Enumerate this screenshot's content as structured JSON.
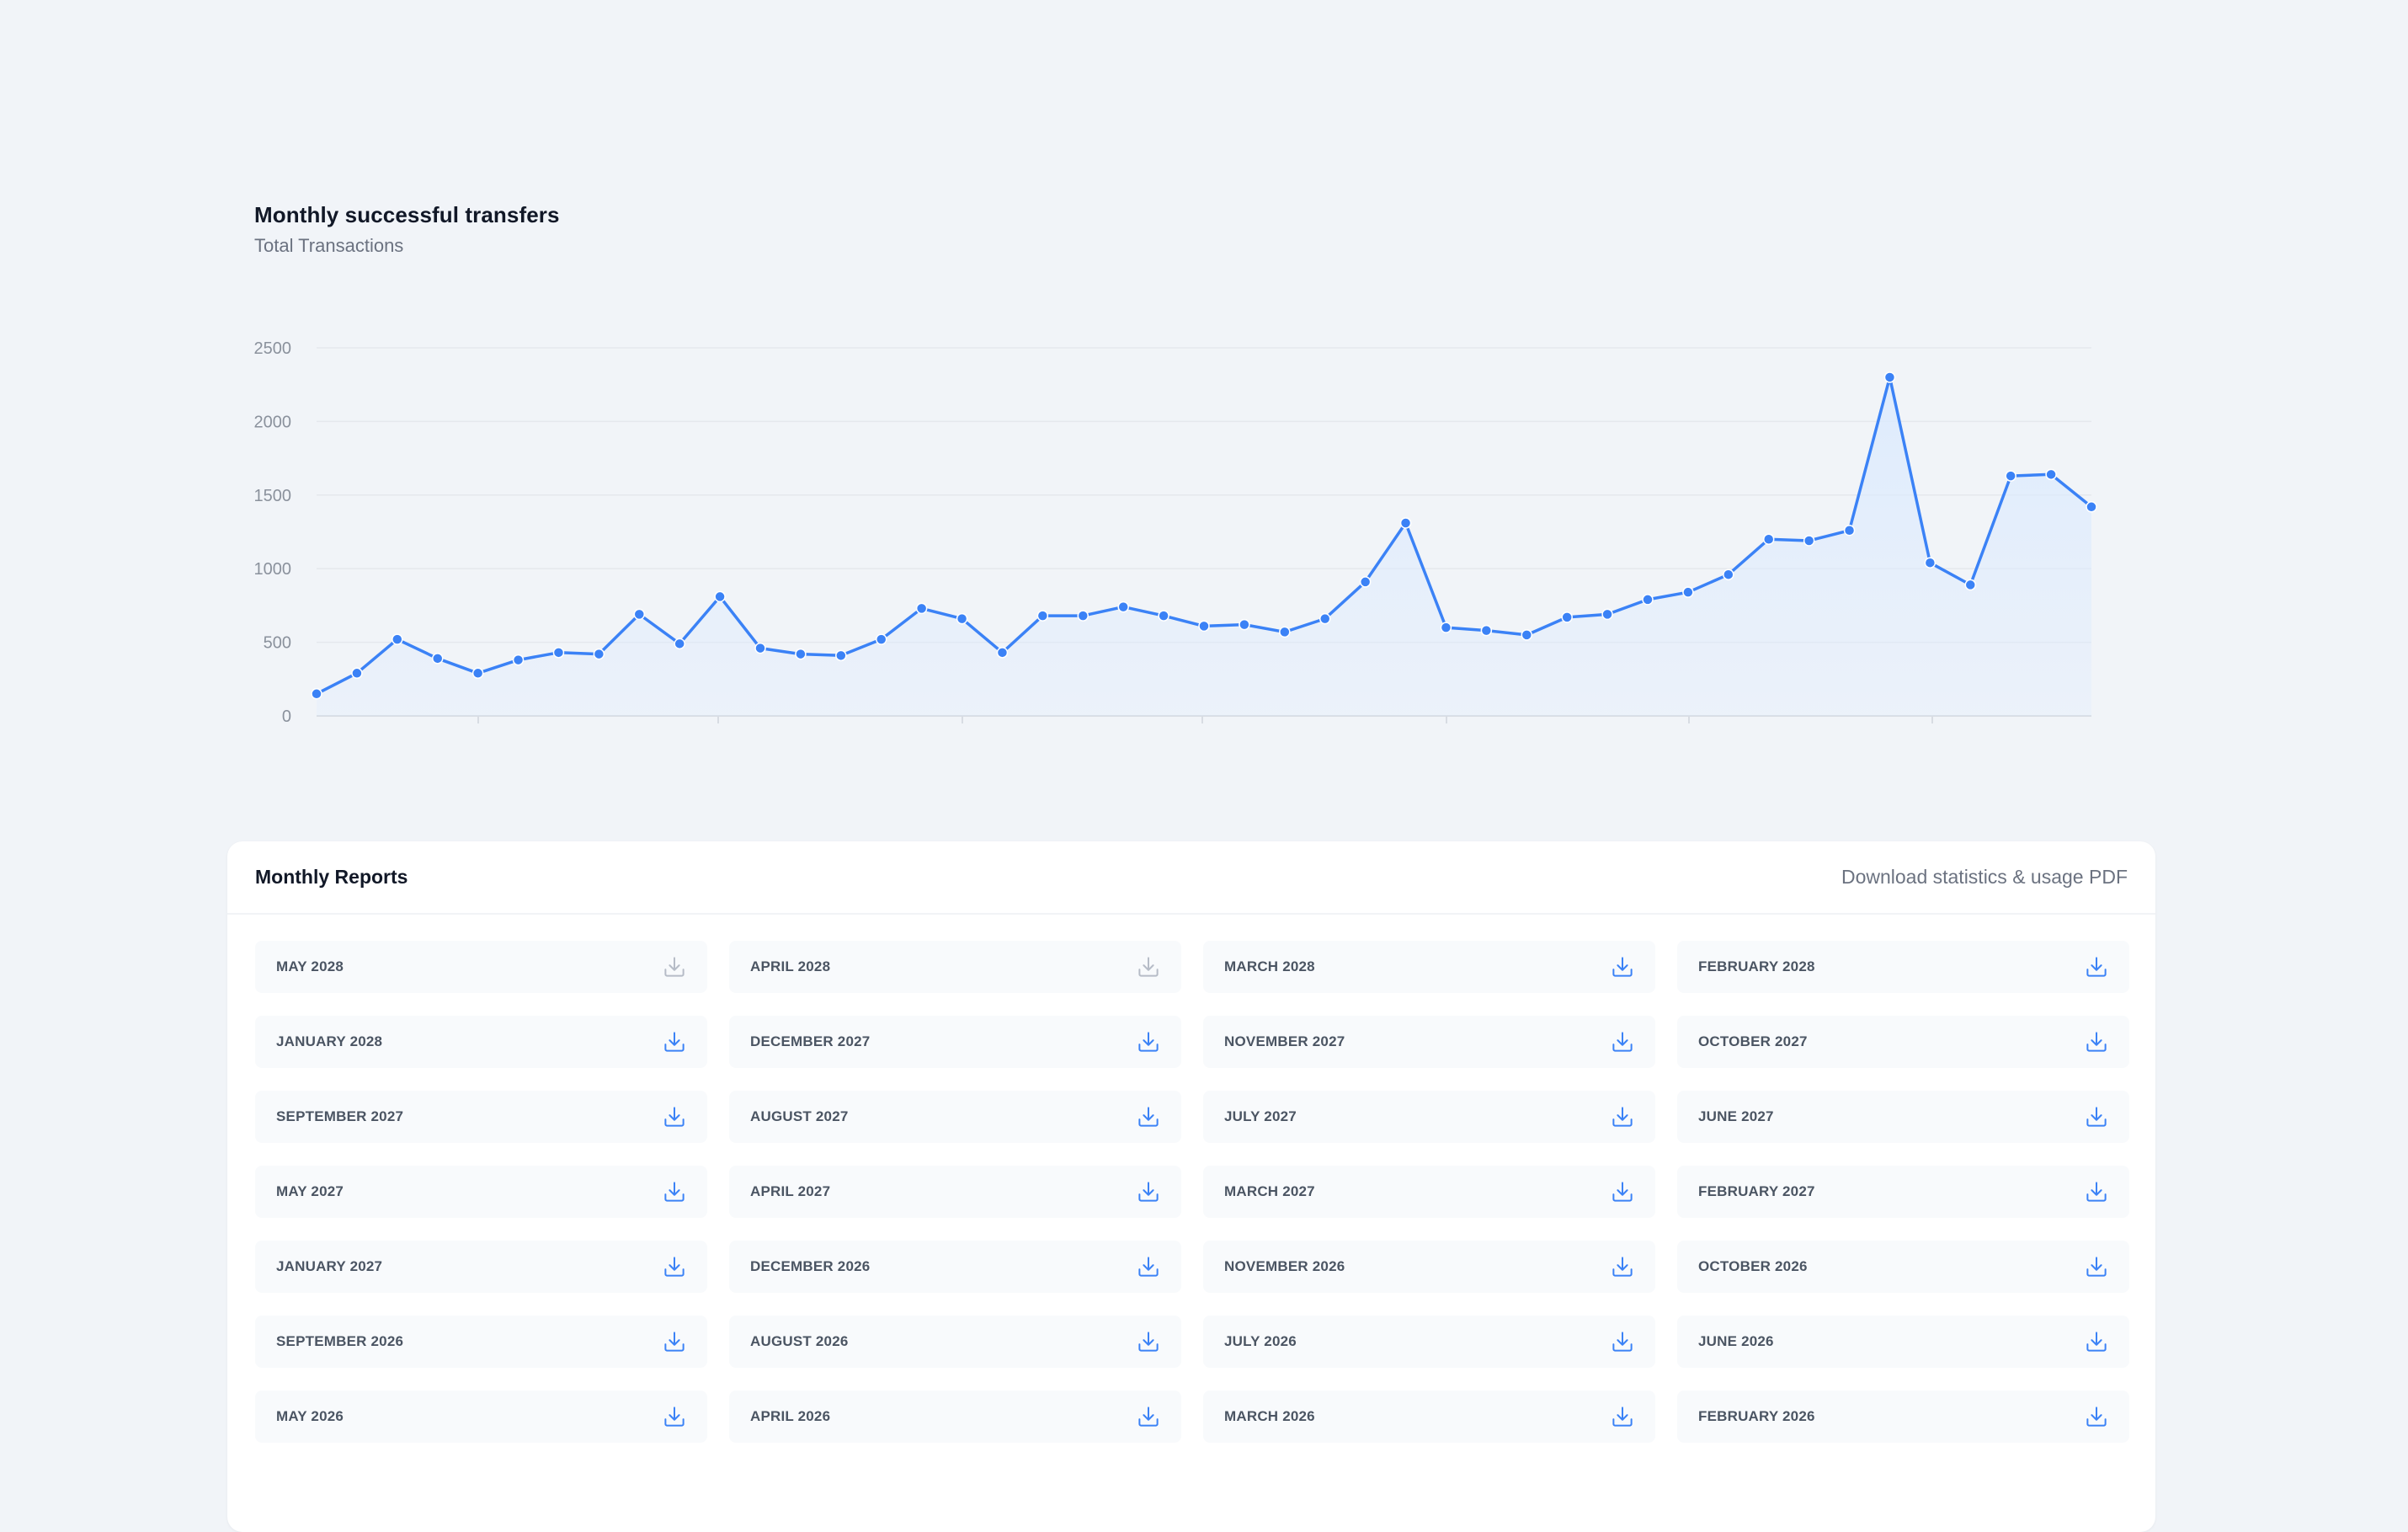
{
  "chart_header": {
    "title": "Monthly successful transfers",
    "subtitle": "Total Transactions"
  },
  "chart_data": {
    "type": "area",
    "ylim": [
      0,
      2500
    ],
    "yticks": [
      0,
      500,
      1000,
      1500,
      2000,
      2500
    ],
    "grid": true,
    "line_color": "#3b82f6",
    "fill_color": "#dbeafe",
    "series": [
      {
        "values": [
          150,
          290,
          520,
          390,
          290,
          380,
          430,
          420,
          690,
          490,
          810,
          460,
          420,
          410,
          520,
          730,
          660,
          430,
          680,
          680,
          740,
          680,
          610,
          620,
          570,
          660,
          910,
          1310,
          600,
          580,
          550,
          670,
          690,
          790,
          840,
          960,
          1200,
          1190,
          1260,
          2300,
          1040,
          890,
          1630,
          1640,
          1420
        ]
      }
    ]
  },
  "reports": {
    "title": "Monthly Reports",
    "download_link": "Download statistics & usage PDF",
    "icon": "download-icon",
    "accent_color": "#3b82f6",
    "disabled_color": "#b6bcc7",
    "items": [
      {
        "label": "MAY 2028",
        "disabled": true
      },
      {
        "label": "APRIL 2028",
        "disabled": true
      },
      {
        "label": "MARCH 2028",
        "disabled": false
      },
      {
        "label": "FEBRUARY 2028",
        "disabled": false
      },
      {
        "label": "JANUARY 2028",
        "disabled": false
      },
      {
        "label": "DECEMBER 2027",
        "disabled": false
      },
      {
        "label": "NOVEMBER 2027",
        "disabled": false
      },
      {
        "label": "OCTOBER 2027",
        "disabled": false
      },
      {
        "label": "SEPTEMBER 2027",
        "disabled": false
      },
      {
        "label": "AUGUST 2027",
        "disabled": false
      },
      {
        "label": "JULY 2027",
        "disabled": false
      },
      {
        "label": "JUNE 2027",
        "disabled": false
      },
      {
        "label": "MAY 2027",
        "disabled": false
      },
      {
        "label": "APRIL 2027",
        "disabled": false
      },
      {
        "label": "MARCH 2027",
        "disabled": false
      },
      {
        "label": "FEBRUARY 2027",
        "disabled": false
      },
      {
        "label": "JANUARY 2027",
        "disabled": false
      },
      {
        "label": "DECEMBER 2026",
        "disabled": false
      },
      {
        "label": "NOVEMBER 2026",
        "disabled": false
      },
      {
        "label": "OCTOBER 2026",
        "disabled": false
      },
      {
        "label": "SEPTEMBER 2026",
        "disabled": false
      },
      {
        "label": "AUGUST 2026",
        "disabled": false
      },
      {
        "label": "JULY 2026",
        "disabled": false
      },
      {
        "label": "JUNE 2026",
        "disabled": false
      },
      {
        "label": "MAY 2026",
        "disabled": false
      },
      {
        "label": "APRIL 2026",
        "disabled": false
      },
      {
        "label": "MARCH 2026",
        "disabled": false
      },
      {
        "label": "FEBRUARY 2026",
        "disabled": false
      }
    ]
  }
}
